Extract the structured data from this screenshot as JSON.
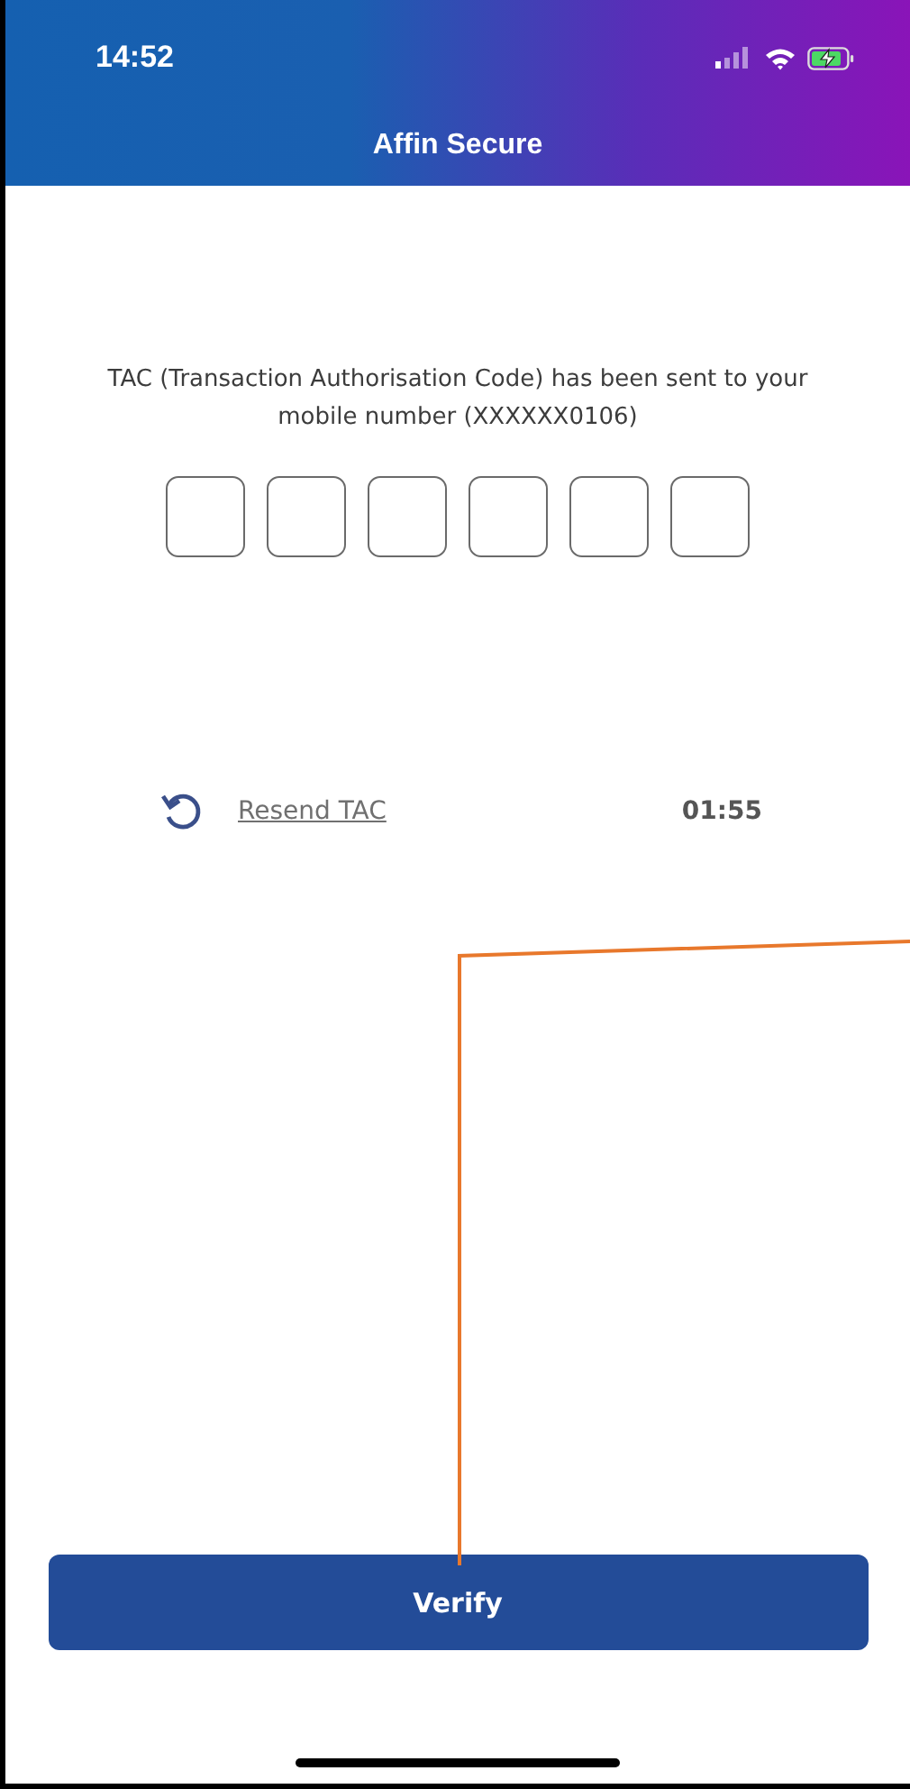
{
  "status_bar": {
    "time": "14:52"
  },
  "header": {
    "title": "Affin Secure"
  },
  "message": "TAC (Transaction Authorisation Code) has been sent to your mobile number  (XXXXXX0106)",
  "code_fields": [
    {
      "filled": false
    },
    {
      "filled": false
    },
    {
      "filled": false
    },
    {
      "filled": false
    },
    {
      "filled": false
    },
    {
      "filled": false
    }
  ],
  "resend": {
    "label": "Resend TAC",
    "timer": "01:55"
  },
  "verify_button": {
    "label": "Verify"
  }
}
